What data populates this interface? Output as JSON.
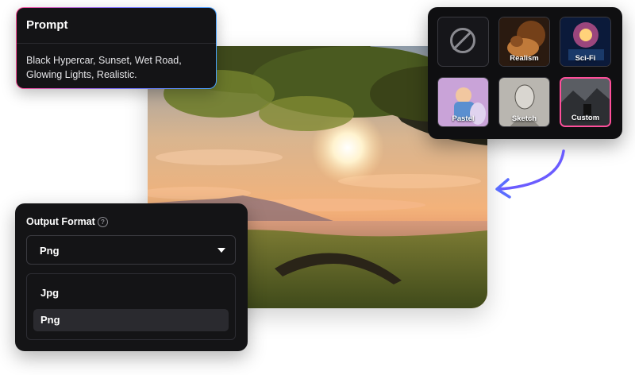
{
  "prompt": {
    "title": "Prompt",
    "text": "Black Hypercar, Sunset, Wet Road, Glowing Lights, Realistic."
  },
  "styles": {
    "tiles": [
      {
        "label": "",
        "icon": "no-style-icon"
      },
      {
        "label": "Realism"
      },
      {
        "label": "Sci-Fi"
      },
      {
        "label": "Pastel"
      },
      {
        "label": "Sketch"
      },
      {
        "label": "Custom",
        "selected": true
      }
    ]
  },
  "output_format": {
    "title": "Output Format",
    "help_icon": "question-circle-icon",
    "selected": "Png",
    "options": [
      "Jpg",
      "Png"
    ]
  },
  "colors": {
    "panel_bg": "#141416",
    "accent_pink": "#ff4f9a",
    "accent_purple": "#7b6cff",
    "arrow": "#6b5cff"
  }
}
